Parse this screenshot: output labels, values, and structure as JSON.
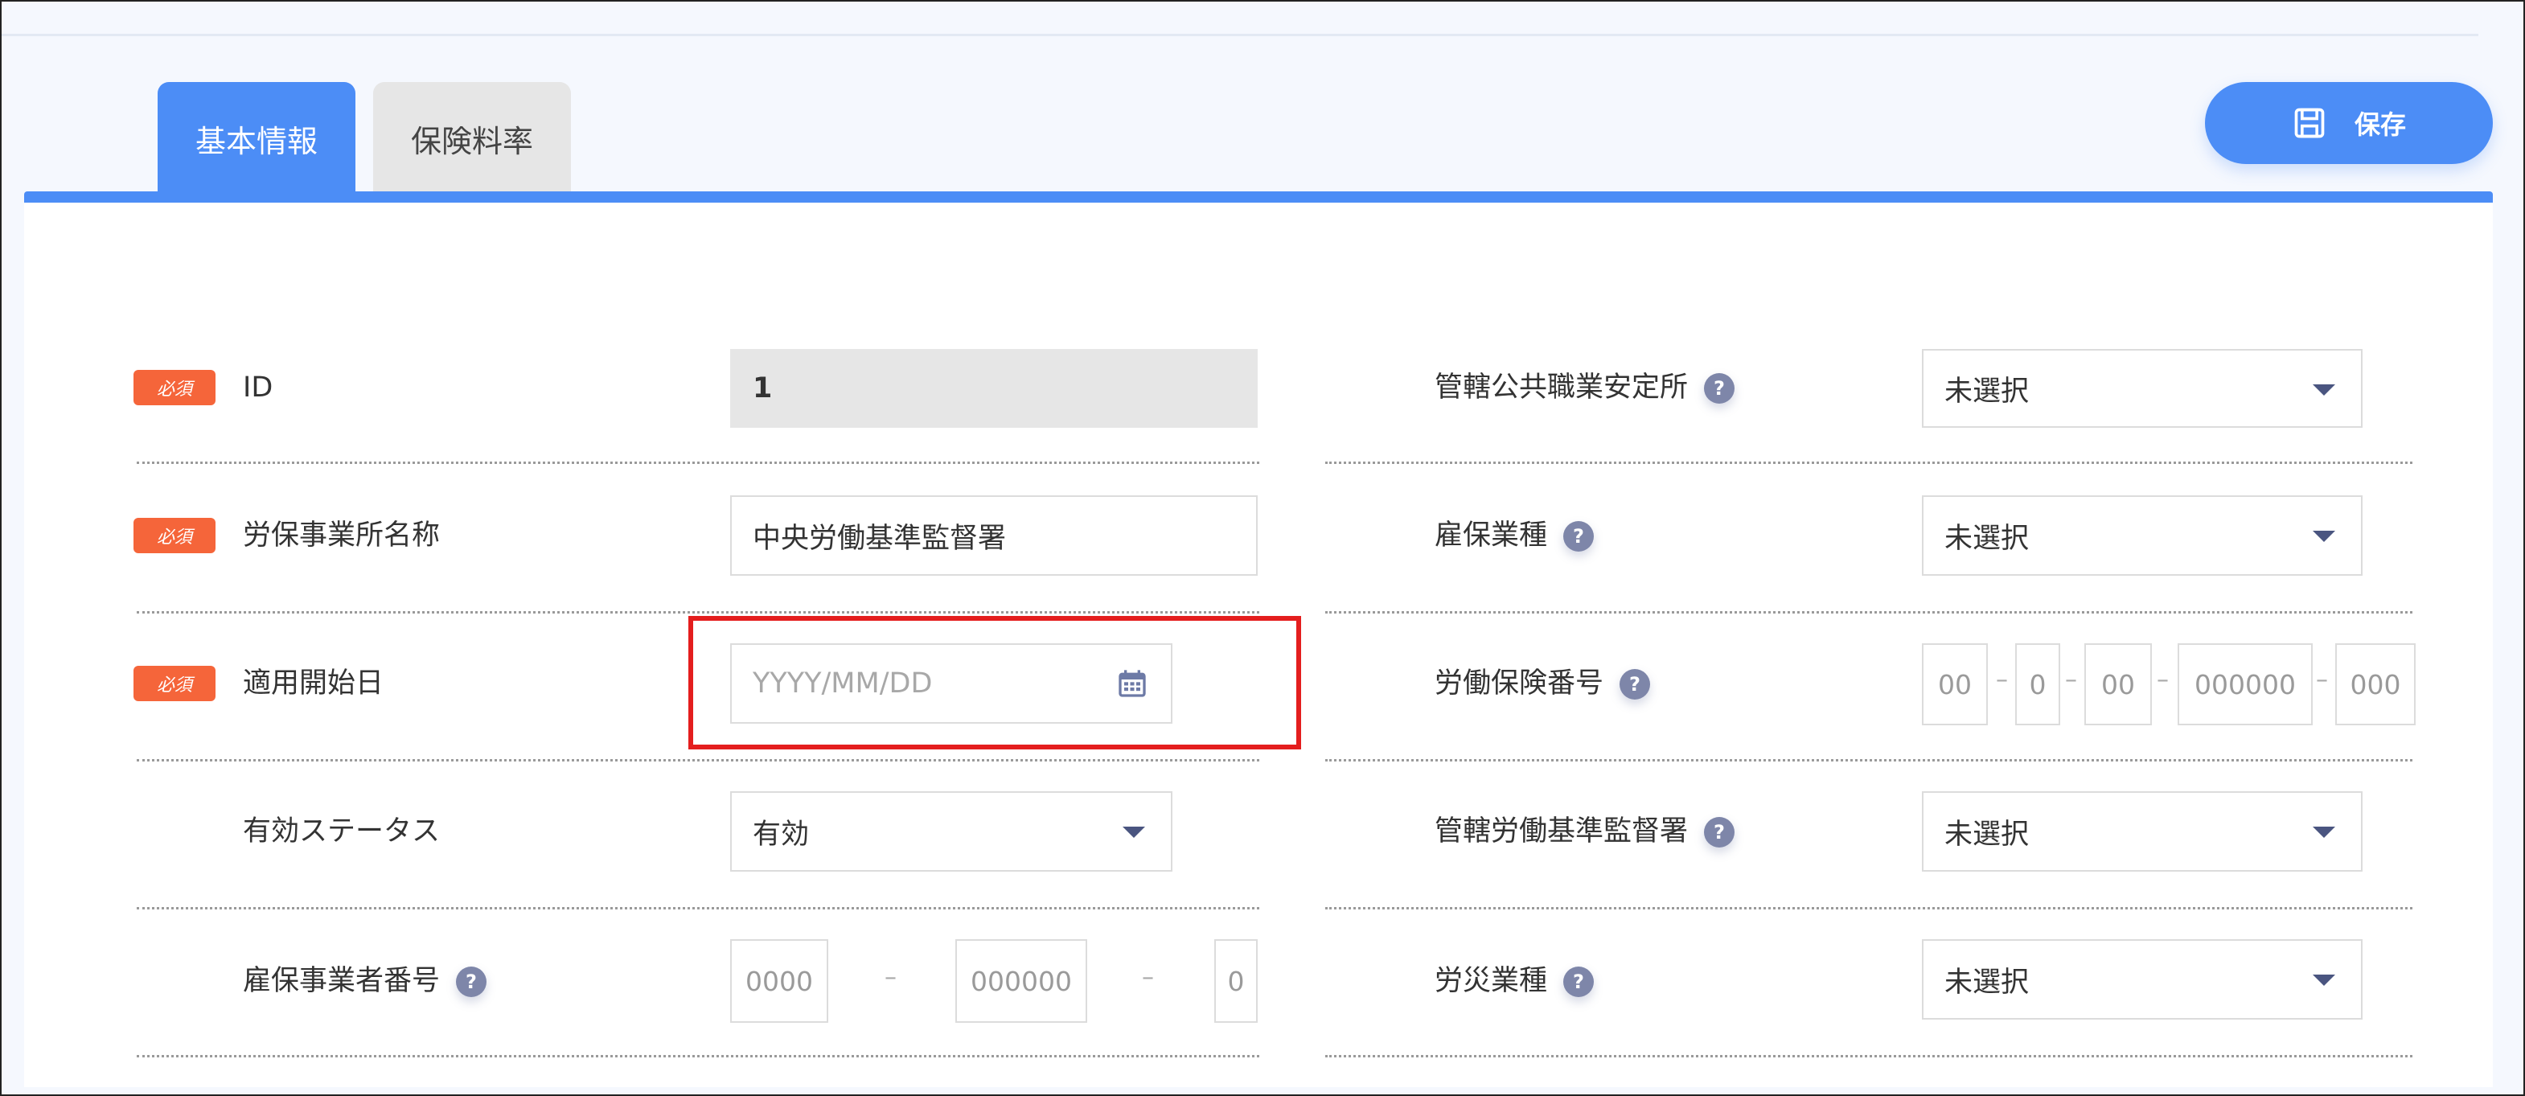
{
  "tabs": [
    {
      "label": "基本情報",
      "active": true
    },
    {
      "label": "保険料率",
      "active": false
    }
  ],
  "save_button": {
    "label": "保存",
    "icon": "save-icon"
  },
  "required_badge": "必須",
  "help_icon": "?",
  "colors": {
    "accent": "#4c8df6",
    "required": "#f5653a",
    "highlight": "#e41e1e"
  },
  "left_fields": {
    "id": {
      "label": "ID",
      "value": "1",
      "required": true
    },
    "office_name": {
      "label": "労保事業所名称",
      "value": "中央労働基準監督署",
      "required": true
    },
    "start_date": {
      "label": "適用開始日",
      "placeholder": "YYYY/MM/DD",
      "required": true
    },
    "status": {
      "label": "有効ステータス",
      "value": "有効"
    },
    "employment_number": {
      "label": "雇保事業者番号",
      "segments": [
        "0000",
        "000000",
        "0"
      ]
    }
  },
  "right_fields": {
    "employment_office": {
      "label": "管轄公共職業安定所",
      "value": "未選択"
    },
    "employment_industry": {
      "label": "雇保業種",
      "value": "未選択"
    },
    "labor_insurance_number": {
      "label": "労働保険番号",
      "segments": [
        "00",
        "0",
        "00",
        "000000",
        "000"
      ]
    },
    "labor_standards_office": {
      "label": "管轄労働基準監督署",
      "value": "未選択"
    },
    "accident_industry": {
      "label": "労災業種",
      "value": "未選択"
    }
  },
  "separator": "–"
}
